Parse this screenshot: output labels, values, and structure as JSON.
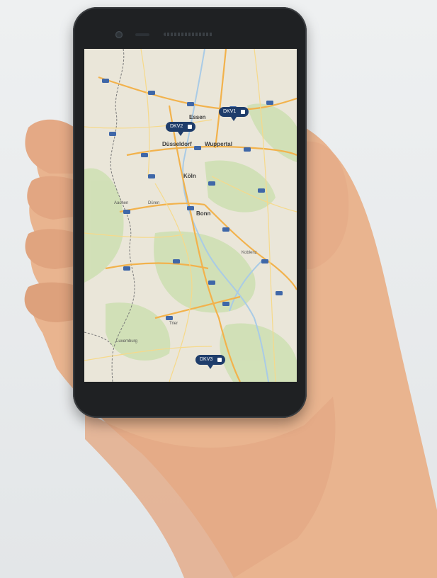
{
  "map": {
    "cities": [
      {
        "name": "Essen"
      },
      {
        "name": "Düsseldorf"
      },
      {
        "name": "Wuppertal"
      },
      {
        "name": "Köln"
      },
      {
        "name": "Bonn"
      },
      {
        "name": "Koblenz"
      },
      {
        "name": "Trier"
      },
      {
        "name": "Luxemburg"
      },
      {
        "name": "Düren"
      },
      {
        "name": "Aachen"
      }
    ],
    "markers": [
      {
        "label": "DKV1"
      },
      {
        "label": "DKV2"
      },
      {
        "label": "DKV3"
      }
    ],
    "colors": {
      "land": "#eae6d9",
      "forest": "#cfe0b4",
      "highway": "#f2b24c",
      "road": "#f6d98a",
      "water": "#a9cbe6",
      "marker": "#1f3d6b",
      "border": "#7a7a7a"
    }
  }
}
